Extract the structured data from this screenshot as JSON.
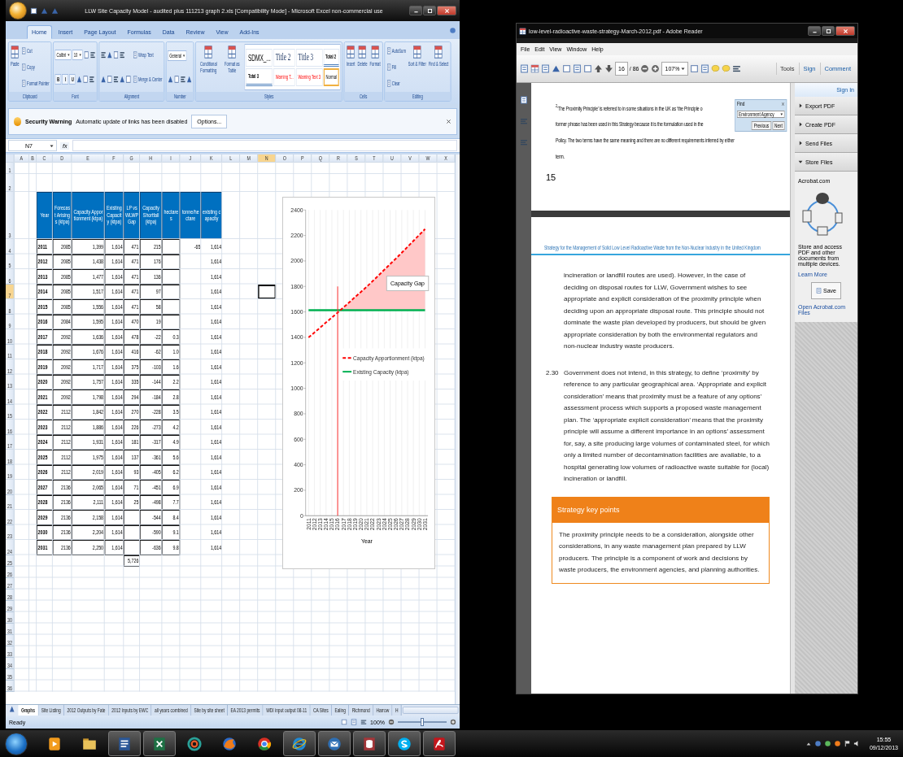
{
  "excel": {
    "title": "LLW Site Capacity Model - audited plus 111213 graph 2.xls [Compatibility Mode] - Microsoft Excel non-commercial use",
    "tabs": [
      {
        "label": "Home",
        "selected": true
      },
      {
        "label": "Insert",
        "selected": false
      },
      {
        "label": "Page Layout",
        "selected": false
      },
      {
        "label": "Formulas",
        "selected": false
      },
      {
        "label": "Data",
        "selected": false
      },
      {
        "label": "Review",
        "selected": false
      },
      {
        "label": "View",
        "selected": false
      },
      {
        "label": "Add-Ins",
        "selected": false
      }
    ],
    "ribbon": [
      {
        "label": "Clipboard",
        "items": [
          {
            "kind": "big",
            "label": "Paste"
          },
          {
            "kind": "stack",
            "lines": [
              {
                "items": [
                  {
                    "kind": "small",
                    "label": "Cut"
                  }
                ]
              },
              {
                "items": [
                  {
                    "kind": "small",
                    "label": "Copy"
                  }
                ]
              },
              {
                "items": [
                  {
                    "kind": "small",
                    "label": "Format Painter"
                  }
                ]
              }
            ]
          }
        ]
      },
      {
        "label": "Font",
        "items": [
          {
            "kind": "stack",
            "lines": [
              {
                "items": [
                  {
                    "kind": "field",
                    "value": "Calibri"
                  },
                  {
                    "kind": "field",
                    "value": "10"
                  },
                  {
                    "kind": "icon"
                  },
                  {
                    "kind": "icon"
                  }
                ]
              },
              {
                "items": [
                  {
                    "kind": "glyph",
                    "label": "B"
                  },
                  {
                    "kind": "glyph",
                    "label": "I"
                  },
                  {
                    "kind": "glyph",
                    "label": "U"
                  },
                  {
                    "kind": "icon"
                  },
                  {
                    "kind": "icon"
                  },
                  {
                    "kind": "icon"
                  }
                ]
              }
            ]
          }
        ]
      },
      {
        "label": "Alignment",
        "items": [
          {
            "kind": "stack",
            "lines": [
              {
                "items": [
                  {
                    "kind": "icon"
                  },
                  {
                    "kind": "icon"
                  },
                  {
                    "kind": "icon"
                  },
                  {
                    "kind": "icon"
                  }
                ]
              },
              {
                "items": [
                  {
                    "kind": "icon"
                  },
                  {
                    "kind": "icon"
                  },
                  {
                    "kind": "icon"
                  },
                  {
                    "kind": "icon"
                  },
                  {
                    "kind": "icon"
                  }
                ]
              }
            ]
          },
          {
            "kind": "stack",
            "lines": [
              {
                "items": [
                  {
                    "kind": "small",
                    "label": "Wrap Text"
                  }
                ]
              },
              {
                "items": [
                  {
                    "kind": "small",
                    "label": "Merge & Center"
                  }
                ]
              }
            ]
          }
        ]
      },
      {
        "label": "Number",
        "items": [
          {
            "kind": "stack",
            "lines": [
              {
                "items": [
                  {
                    "kind": "field",
                    "value": "General"
                  }
                ]
              },
              {
                "items": [
                  {
                    "kind": "icon"
                  },
                  {
                    "kind": "icon"
                  },
                  {
                    "kind": "icon"
                  },
                  {
                    "kind": "icon"
                  }
                ]
              }
            ]
          }
        ]
      },
      {
        "label": "Styles",
        "items": [
          {
            "kind": "big",
            "label": "Conditional Formatting"
          },
          {
            "kind": "big",
            "label": "Format as Table"
          },
          {
            "kind": "gallery",
            "styles": [
              {
                "label": "SDMX_...",
                "kind": "large",
                "selected": false
              },
              {
                "label": "Title 2",
                "kind": "heading",
                "selected": false
              },
              {
                "label": "Title 3",
                "kind": "heading",
                "selected": false
              },
              {
                "label": "Total 2",
                "kind": "total",
                "selected": false
              },
              {
                "label": "Total 3",
                "kind": "total",
                "selected": false
              },
              {
                "label": "Warning T...",
                "kind": "warning",
                "selected": false
              },
              {
                "label": "Warning Text 3",
                "kind": "warning",
                "selected": false
              },
              {
                "label": "Normal",
                "kind": "normal",
                "selected": true
              }
            ]
          }
        ]
      },
      {
        "label": "Cells",
        "items": [
          {
            "kind": "big",
            "label": "Insert"
          },
          {
            "kind": "big",
            "label": "Delete"
          },
          {
            "kind": "big",
            "label": "Format"
          }
        ]
      },
      {
        "label": "Editing",
        "items": [
          {
            "kind": "stack",
            "lines": [
              {
                "items": [
                  {
                    "kind": "small",
                    "label": "AutoSum"
                  }
                ]
              },
              {
                "items": [
                  {
                    "kind": "small",
                    "label": "Fill"
                  }
                ]
              },
              {
                "items": [
                  {
                    "kind": "small",
                    "label": "Clear"
                  }
                ]
              }
            ]
          },
          {
            "kind": "big",
            "label": "Sort & Filter"
          },
          {
            "kind": "big",
            "label": "Find & Select"
          }
        ]
      }
    ],
    "security_bar": {
      "title": "Security Warning",
      "message": "Automatic update of links has been disabled",
      "button": "Options..."
    },
    "name_box": "N7",
    "function_button": "fx",
    "columns": [
      {
        "label": "A",
        "selected": false
      },
      {
        "label": "B",
        "selected": false
      },
      {
        "label": "C",
        "selected": false
      },
      {
        "label": "D",
        "selected": false
      },
      {
        "label": "E",
        "selected": false
      },
      {
        "label": "F",
        "selected": false
      },
      {
        "label": "G",
        "selected": false
      },
      {
        "label": "H",
        "selected": false
      },
      {
        "label": "I",
        "selected": false
      },
      {
        "label": "J",
        "selected": false
      },
      {
        "label": "K",
        "selected": false
      },
      {
        "label": "L",
        "selected": false
      },
      {
        "label": "M",
        "selected": false
      },
      {
        "label": "N",
        "selected": true
      },
      {
        "label": "O",
        "selected": false
      },
      {
        "label": "P",
        "selected": false
      },
      {
        "label": "Q",
        "selected": false
      },
      {
        "label": "R",
        "selected": false
      },
      {
        "label": "S",
        "selected": false
      },
      {
        "label": "T",
        "selected": false
      },
      {
        "label": "U",
        "selected": false
      },
      {
        "label": "V",
        "selected": false
      },
      {
        "label": "W",
        "selected": false
      },
      {
        "label": "X",
        "selected": false
      }
    ],
    "row_numbers": [
      {
        "label": "1",
        "selected": false
      },
      {
        "label": "2",
        "selected": false
      },
      {
        "label": "3",
        "selected": false
      },
      {
        "label": "4",
        "selected": false
      },
      {
        "label": "5",
        "selected": false
      },
      {
        "label": "6",
        "selected": false
      },
      {
        "label": "7",
        "selected": true
      },
      {
        "label": "8",
        "selected": false
      },
      {
        "label": "9",
        "selected": false
      },
      {
        "label": "10",
        "selected": false
      },
      {
        "label": "11",
        "selected": false
      },
      {
        "label": "12",
        "selected": false
      },
      {
        "label": "13",
        "selected": false
      },
      {
        "label": "14",
        "selected": false
      },
      {
        "label": "15",
        "selected": false
      },
      {
        "label": "16",
        "selected": false
      },
      {
        "label": "17",
        "selected": false
      },
      {
        "label": "18",
        "selected": false
      },
      {
        "label": "19",
        "selected": false
      },
      {
        "label": "20",
        "selected": false
      },
      {
        "label": "21",
        "selected": false
      },
      {
        "label": "22",
        "selected": false
      },
      {
        "label": "23",
        "selected": false
      },
      {
        "label": "24",
        "selected": false
      },
      {
        "label": "25",
        "selected": false
      },
      {
        "label": "26",
        "selected": false
      },
      {
        "label": "27",
        "selected": false
      },
      {
        "label": "28",
        "selected": false
      },
      {
        "label": "29",
        "selected": false
      },
      {
        "label": "30",
        "selected": false
      },
      {
        "label": "31",
        "selected": false
      },
      {
        "label": "32",
        "selected": false
      },
      {
        "label": "33",
        "selected": false
      },
      {
        "label": "34",
        "selected": false
      },
      {
        "label": "35",
        "selected": false
      },
      {
        "label": "36",
        "selected": false
      }
    ],
    "table": {
      "header": [
        "Year",
        "Forecast Arisings (ktpa)",
        "Capacity Apportionment (ktpa)",
        "Existing Capacity (ktpa)",
        "LP vs WLWP Gap",
        "Capacity Shortfall (ktpa)",
        "hectares",
        "tonne/hectare",
        "existing capacity"
      ],
      "rows": [
        [
          "2011",
          "2085",
          "1,399",
          "1,614",
          "471",
          "215",
          "",
          "-65",
          "1,614"
        ],
        [
          "2012",
          "2085",
          "1,438",
          "1,614",
          "471",
          "176",
          "",
          "",
          "1,614"
        ],
        [
          "2013",
          "2085",
          "1,477",
          "1,614",
          "471",
          "136",
          "",
          "",
          "1,614"
        ],
        [
          "2014",
          "2085",
          "1,517",
          "1,614",
          "471",
          "97",
          "",
          "",
          "1,614"
        ],
        [
          "2015",
          "2085",
          "1,556",
          "1,614",
          "471",
          "58",
          "",
          "",
          "1,614"
        ],
        [
          "2016",
          "2084",
          "1,595",
          "1,614",
          "470",
          "19",
          "",
          "",
          "1,614"
        ],
        [
          "2017",
          "2092",
          "1,636",
          "1,614",
          "478",
          "-22",
          "0.3",
          "",
          "1,614"
        ],
        [
          "2018",
          "2092",
          "1,676",
          "1,614",
          "416",
          "-62",
          "1.0",
          "",
          "1,614"
        ],
        [
          "2019",
          "2092",
          "1,717",
          "1,614",
          "375",
          "-103",
          "1.6",
          "",
          "1,614"
        ],
        [
          "2020",
          "2092",
          "1,757",
          "1,614",
          "335",
          "-144",
          "2.2",
          "",
          "1,614"
        ],
        [
          "2021",
          "2092",
          "1,798",
          "1,614",
          "294",
          "-184",
          "2.8",
          "",
          "1,614"
        ],
        [
          "2022",
          "2112",
          "1,842",
          "1,614",
          "270",
          "-228",
          "3.5",
          "",
          "1,614"
        ],
        [
          "2023",
          "2112",
          "1,886",
          "1,614",
          "226",
          "-273",
          "4.2",
          "",
          "1,614"
        ],
        [
          "2024",
          "2112",
          "1,931",
          "1,614",
          "181",
          "-317",
          "4.9",
          "",
          "1,614"
        ],
        [
          "2025",
          "2112",
          "1,975",
          "1,614",
          "137",
          "-361",
          "5.6",
          "",
          "1,614"
        ],
        [
          "2026",
          "2112",
          "2,019",
          "1,614",
          "93",
          "-405",
          "6.2",
          "",
          "1,614"
        ],
        [
          "2027",
          "2136",
          "2,065",
          "1,614",
          "71",
          "-451",
          "6.9",
          "",
          "1,614"
        ],
        [
          "2028",
          "2136",
          "2,111",
          "1,614",
          "25",
          "-498",
          "7.7",
          "",
          "1,614"
        ],
        [
          "2029",
          "2136",
          "2,158",
          "1,614",
          "",
          "-544",
          "8.4",
          "",
          "1,614"
        ],
        [
          "2030",
          "2136",
          "2,204",
          "1,614",
          "",
          "-590",
          "9.1",
          "",
          "1,614"
        ],
        [
          "2031",
          "2136",
          "2,250",
          "1,614",
          "",
          "-636",
          "9.8",
          "",
          "1,614"
        ]
      ],
      "total": "5,726"
    },
    "chart_data": {
      "type": "line",
      "xlabel": "Year",
      "categories": [
        "2011",
        "2012",
        "2013",
        "2014",
        "2015",
        "2016",
        "2017",
        "2018",
        "2019",
        "2020",
        "2021",
        "2022",
        "2023",
        "2024",
        "2025",
        "2026",
        "2027",
        "2028",
        "2029",
        "2030",
        "2031"
      ],
      "series": [
        {
          "name": "Capacity Apportionment (ktpa)",
          "color": "#ff0000",
          "line_style": "dashed",
          "values": [
            1399,
            1438,
            1477,
            1517,
            1556,
            1595,
            1636,
            1676,
            1717,
            1757,
            1798,
            1842,
            1886,
            1931,
            1975,
            2019,
            2065,
            2111,
            2158,
            2204,
            2250
          ]
        },
        {
          "name": "Existing Capacity (ktpa)",
          "color": "#00b050",
          "line_style": "solid",
          "values": [
            1614,
            1614,
            1614,
            1614,
            1614,
            1614,
            1614,
            1614,
            1614,
            1614,
            1614,
            1614,
            1614,
            1614,
            1614,
            1614,
            1614,
            1614,
            1614,
            1614,
            1614
          ]
        }
      ],
      "ylim": [
        0,
        2400
      ],
      "yticks": [
        0,
        200,
        400,
        600,
        800,
        1000,
        1200,
        1400,
        1600,
        1800,
        2000,
        2200,
        2400
      ],
      "grid": true,
      "legend": true,
      "annotations": [
        "Capacity Gap"
      ],
      "ref_lines": [
        {
          "axis": "x",
          "value": "2016",
          "color": "#ff3030"
        }
      ]
    },
    "sheet_tabs": [
      {
        "label": "Graphs",
        "selected": true
      },
      {
        "label": "Site Listing",
        "selected": false
      },
      {
        "label": "2012 Outputs by Fate",
        "selected": false
      },
      {
        "label": "2012 Inputs by EWC",
        "selected": false
      },
      {
        "label": "all years combined",
        "selected": false
      },
      {
        "label": "Site by site sheet",
        "selected": false
      },
      {
        "label": "EA 2013 permits",
        "selected": false
      },
      {
        "label": "WDI input output 08-11",
        "selected": false
      },
      {
        "label": "CA Sites",
        "selected": false
      },
      {
        "label": "Ealing",
        "selected": false
      },
      {
        "label": "Richmond",
        "selected": false
      },
      {
        "label": "Harrow",
        "selected": false
      },
      {
        "label": "H",
        "selected": false
      }
    ],
    "status": "Ready",
    "zoom": "100%",
    "zoom_slider": {
      "level": 0.5
    }
  },
  "reader": {
    "title": "low-level-radioactive-waste-strategy-March-2012.pdf - Adobe Reader",
    "menu": [
      "File",
      "Edit",
      "View",
      "Window",
      "Help"
    ],
    "page": "16",
    "page_count": "/ 86",
    "zoom": "107%",
    "panes": [
      "Tools",
      "Sign",
      "Comment"
    ],
    "find": {
      "title": "Find",
      "query": "Environment Agency",
      "buttons": [
        "Previous",
        "Next"
      ]
    },
    "footnote": [
      "$^{2}$‘The Proximity Principle’ is referred to in some situations in the UK as ‘the Principle o",
      "former phrase has been used in this Strategy because it is the formulation used in the",
      "Policy. The two terms have the same meaning and there are no different requirements inferred by either",
      "term."
    ],
    "page_number": "15",
    "running_header": "Strategy for the Management of Solid Low Level Radioactive Waste from the Non-Nuclear Industry in the United Kingdom",
    "paragraphs": [
      {
        "text": "incineration or landfill routes are used). However, in the case of deciding on disposal routes for LLW, Government wishes to see appropriate and explicit consideration of the proximity principle when deciding upon an appropriate disposal route. This principle should not dominate the waste plan developed by producers, but should be given appropriate consideration by both the environmental regulators and non-nuclear industry waste producers."
      },
      {
        "number": "2.30",
        "text": "Government does not intend, in this strategy, to define ‘proximity’ by reference to any particular geographical area. ‘Appropriate and explicit consideration’ means that proximity must be a feature of any options’ assessment process which supports a proposed waste management plan. The ‘appropriate explicit consideration’ means that the proximity principle will assume a different importance in an options’ assessment for, say, a site producing large volumes of contaminated steel, for which only a limited number of decontamination facilities are available, to a hospital generating low volumes of radioactive waste suitable for (local) incineration or landfill."
      }
    ],
    "key_points": {
      "title": "Strategy key points",
      "text": "The proximity principle needs to be a consideration, alongside other considerations, in any waste management plan prepared by LLW producers. The principle is a component of work and decisions by waste producers, the environment agencies, and planning authorities."
    },
    "side_panel": {
      "sign_in": "Sign In",
      "sections": [
        {
          "label": "Export PDF",
          "expanded": false
        },
        {
          "label": "Create PDF",
          "expanded": false
        },
        {
          "label": "Send Files",
          "expanded": false
        },
        {
          "label": "Store Files",
          "expanded": true
        }
      ],
      "service": "Acrobat.com",
      "description": "Store and access PDF and other documents from multiple devices.",
      "learn_more": "Learn More",
      "save": "Save",
      "open_files": "Open Acrobat.com Files"
    }
  },
  "taskbar": {
    "apps": [
      {
        "open": false
      },
      {
        "open": false
      },
      {
        "open": true
      },
      {
        "open": true
      },
      {
        "open": false
      },
      {
        "open": false
      },
      {
        "open": false
      },
      {
        "open": true
      },
      {
        "open": true
      },
      {
        "open": true
      },
      {
        "open": true
      },
      {
        "open": true
      }
    ],
    "time": "15:55",
    "date": "09/12/2013"
  }
}
